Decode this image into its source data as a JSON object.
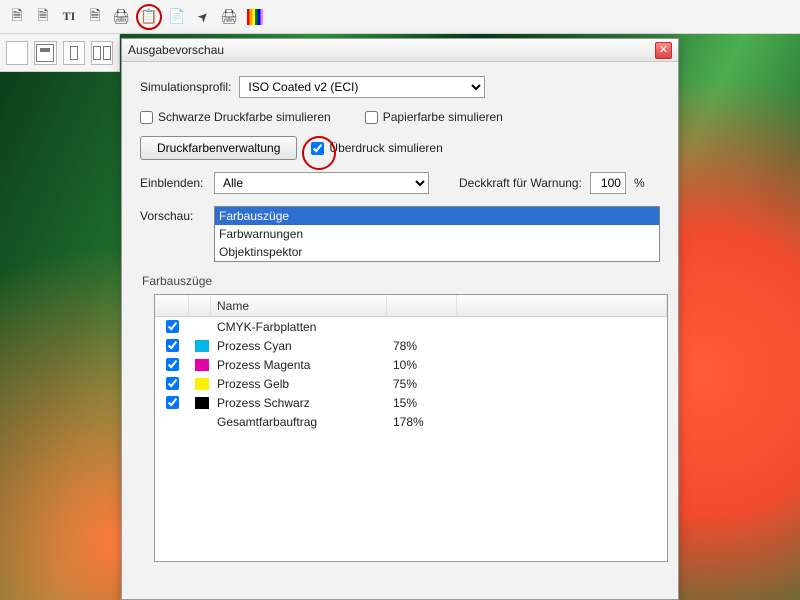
{
  "toolbar": {
    "icons": [
      "doc",
      "doc",
      "TI",
      "doc",
      "print",
      "clipboard",
      "export",
      "cursor",
      "print-gear",
      "rainbow"
    ]
  },
  "dialog": {
    "title": "Ausgabevorschau",
    "simprofile_label": "Simulationsprofil:",
    "simprofile_value": "ISO Coated v2 (ECI)",
    "chk_blackink": "Schwarze Druckfarbe simulieren",
    "chk_blackink_on": false,
    "chk_paper": "Papierfarbe simulieren",
    "chk_paper_on": false,
    "btn_inkmgr": "Druckfarbenverwaltung",
    "chk_overprint": "Überdruck simulieren",
    "chk_overprint_on": true,
    "einblenden_label": "Einblenden:",
    "einblenden_value": "Alle",
    "opacity_label": "Deckkraft für Warnung:",
    "opacity_value": "100",
    "opacity_unit": "%",
    "vorschau_label": "Vorschau:",
    "vorschau_items": [
      "Farbauszüge",
      "Farbwarnungen",
      "Objektinspektor"
    ],
    "vorschau_selected": 0,
    "separations_label": "Farbauszüge",
    "col_name": "Name",
    "rows": [
      {
        "checked": true,
        "swatch": "",
        "name": "CMYK-Farbplatten",
        "pct": ""
      },
      {
        "checked": true,
        "swatch": "#00b7eb",
        "name": "Prozess Cyan",
        "pct": "78%"
      },
      {
        "checked": true,
        "swatch": "#e400a1",
        "name": "Prozess Magenta",
        "pct": "10%"
      },
      {
        "checked": true,
        "swatch": "#fff200",
        "name": "Prozess Gelb",
        "pct": "75%"
      },
      {
        "checked": true,
        "swatch": "#000000",
        "name": "Prozess Schwarz",
        "pct": "15%"
      },
      {
        "checked": false,
        "swatch": "",
        "name": "Gesamtfarbauftrag",
        "pct": "178%",
        "nocheck": true
      }
    ]
  }
}
